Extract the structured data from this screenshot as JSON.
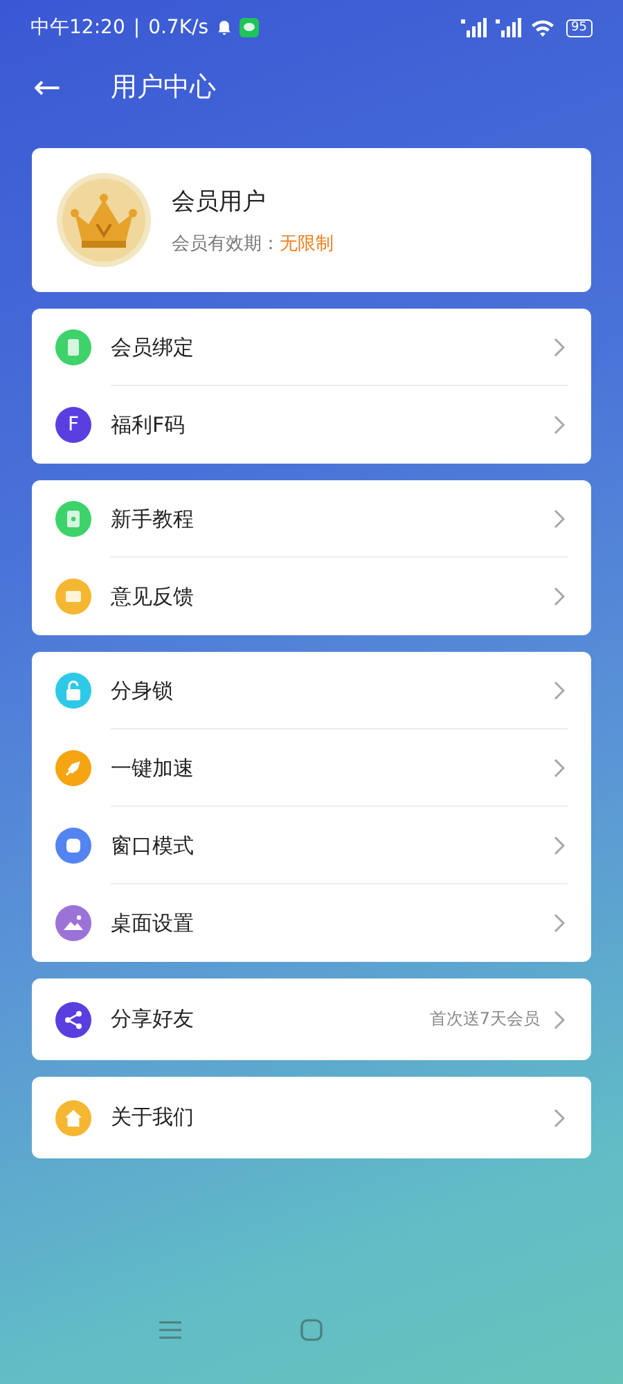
{
  "status_bar": {
    "time": "中午12:20",
    "separator": "|",
    "speed": "0.7K/s",
    "battery": "95"
  },
  "header": {
    "back": "←",
    "title": "用户中心"
  },
  "profile": {
    "name": "会员用户",
    "validity_label": "会员有效期：",
    "validity_value": "无限制"
  },
  "groups": [
    {
      "items": [
        {
          "label": "会员绑定",
          "color": "#3ed26a"
        },
        {
          "label": "福利F码",
          "color": "#5b3ee0",
          "badge": "F"
        }
      ]
    },
    {
      "items": [
        {
          "label": "新手教程",
          "color": "#3ed26a"
        },
        {
          "label": "意见反馈",
          "color": "#f5b731"
        }
      ]
    },
    {
      "items": [
        {
          "label": "分身锁",
          "color": "#2ec9e6"
        },
        {
          "label": "一键加速",
          "color": "#f5a511"
        },
        {
          "label": "窗口模式",
          "color": "#5384f2"
        },
        {
          "label": "桌面设置",
          "color": "#9b72d6"
        }
      ]
    },
    {
      "items": [
        {
          "label": "分享好友",
          "color": "#5b3ee0",
          "note": "首次送7天会员"
        }
      ]
    },
    {
      "items": [
        {
          "label": "关于我们",
          "color": "#f5b731"
        }
      ]
    }
  ]
}
